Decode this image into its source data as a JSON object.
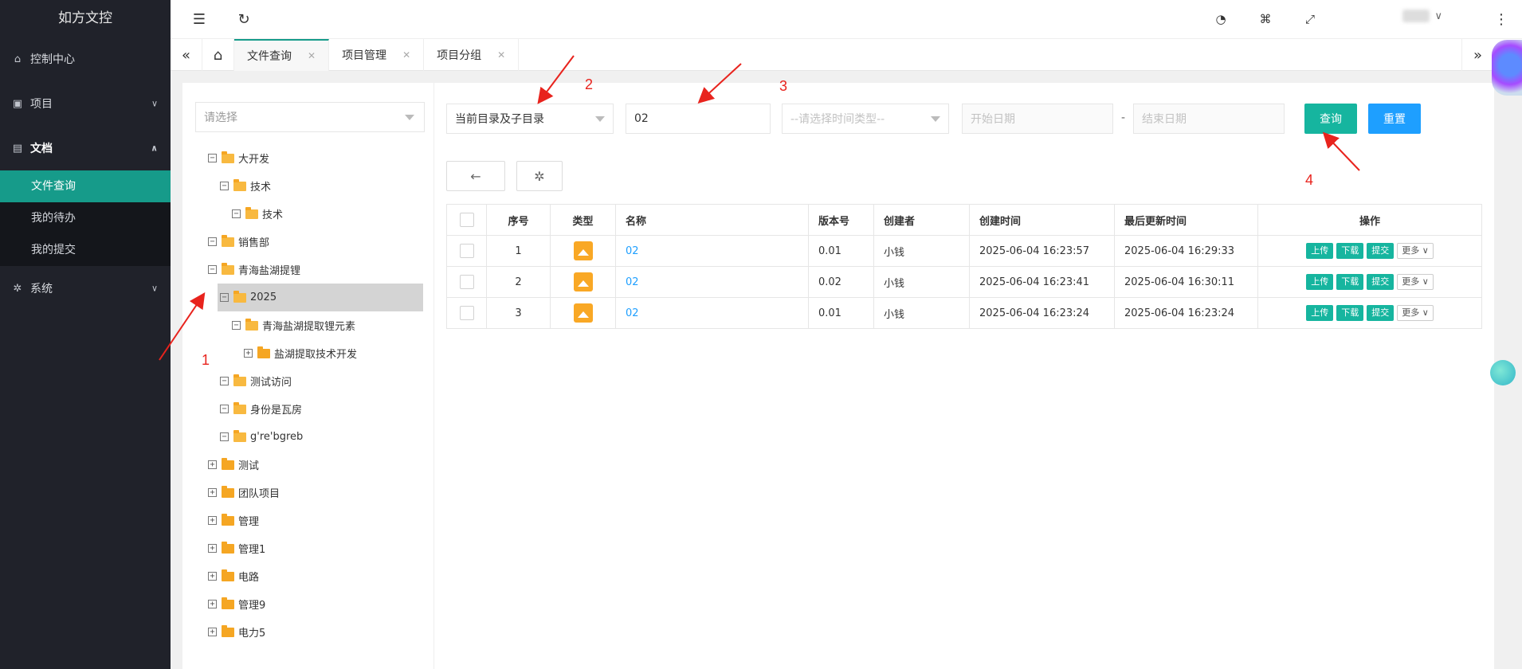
{
  "sidebar": {
    "brand": "如方文控",
    "items": [
      {
        "label": "控制中心",
        "icon": "home-icon"
      },
      {
        "label": "项目",
        "icon": "project-icon"
      },
      {
        "label": "文档",
        "icon": "document-icon"
      },
      {
        "label": "系统",
        "icon": "gear-icon"
      }
    ],
    "submenu": [
      "文件查询",
      "我的待办",
      "我的提交"
    ]
  },
  "tabs": [
    {
      "label": "文件查询"
    },
    {
      "label": "项目管理"
    },
    {
      "label": "项目分组"
    }
  ],
  "tree": {
    "placeholder": "请选择",
    "nodes": [
      "大开发",
      "技术",
      "技术",
      "销售部",
      "青海盐湖提锂",
      "2025",
      "青海盐湖提取锂元素",
      "盐湖提取技术开发",
      "测试访问",
      "身份是瓦房",
      "g're'bgreb",
      "测试",
      "团队项目",
      "管理",
      "管理1",
      "电路",
      "管理9",
      "电力5"
    ]
  },
  "filters": {
    "scope": "当前目录及子目录",
    "keyword": "02",
    "time_type_placeholder": "--请选择时间类型--",
    "start_placeholder": "开始日期",
    "end_placeholder": "结束日期",
    "separator": "-",
    "query_label": "查询",
    "reset_label": "重置"
  },
  "table": {
    "headers": [
      "序号",
      "类型",
      "名称",
      "版本号",
      "创建者",
      "创建时间",
      "最后更新时间",
      "操作"
    ],
    "rows": [
      {
        "no": "1",
        "name": "02",
        "version": "0.01",
        "creator": "小钱",
        "created": "2025-06-04 16:23:57",
        "updated": "2025-06-04 16:29:33"
      },
      {
        "no": "2",
        "name": "02",
        "version": "0.02",
        "creator": "小钱",
        "created": "2025-06-04 16:23:41",
        "updated": "2025-06-04 16:30:11"
      },
      {
        "no": "3",
        "name": "02",
        "version": "0.01",
        "creator": "小钱",
        "created": "2025-06-04 16:23:24",
        "updated": "2025-06-04 16:23:24"
      }
    ],
    "ops": {
      "upload": "上传",
      "download": "下载",
      "submit": "提交",
      "more": "更多"
    }
  },
  "annotations": [
    "1",
    "2",
    "3",
    "4"
  ],
  "colors": {
    "accent": "#169b8a",
    "primary": "#1e9fff",
    "annotation": "#e8231d",
    "sidebar": "#20222a"
  }
}
